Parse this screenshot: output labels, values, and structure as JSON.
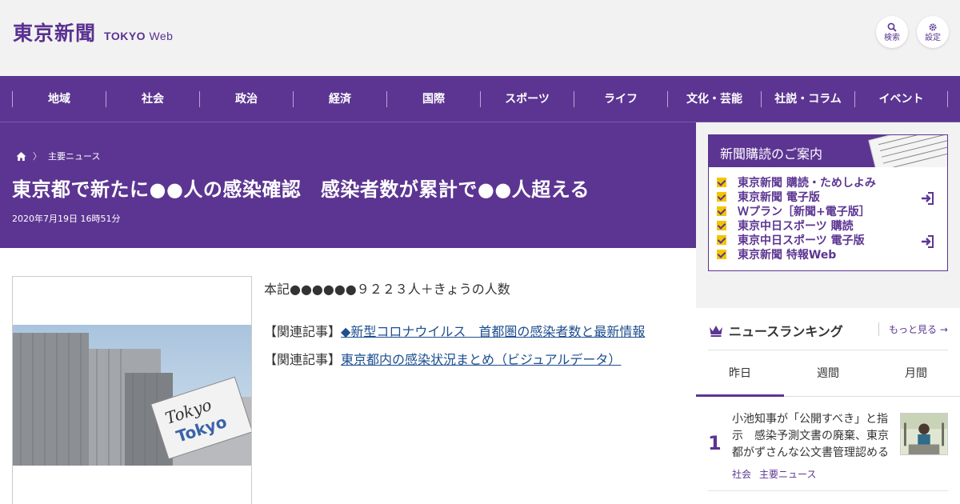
{
  "header": {
    "logo_jp": "東京新聞",
    "logo_en": "TOKYO",
    "logo_web": "Web",
    "search_label": "検索",
    "settings_label": "設定"
  },
  "nav": {
    "items": [
      "地域",
      "社会",
      "政治",
      "経済",
      "国際",
      "スポーツ",
      "ライフ",
      "文化・芸能",
      "社説・コラム",
      "イベント"
    ]
  },
  "article": {
    "breadcrumb": "主要ニュース",
    "title": "東京都で新たに●●人の感染確認　感染者数が累計で●●人超える",
    "date": "2020年7月19日 16時51分",
    "body": "本記●●●●●●９２２３人＋きょうの人数",
    "related_prefix": "【関連記事】",
    "related_links": [
      "◆新型コロナウイルス　首都圏の感染者数と最新情報",
      "東京都内の感染状況まとめ（ビジュアルデータ）"
    ]
  },
  "subscription": {
    "title": "新聞購読のご案内",
    "items": [
      "東京新聞 購読・ためしよみ",
      "東京新聞 電子版",
      "Ｗプラン［新聞+電子版］",
      "東京中日スポーツ 購読",
      "東京中日スポーツ 電子版",
      "東京新聞 特報Web"
    ]
  },
  "ranking": {
    "title": "ニュースランキング",
    "more": "もっと見る",
    "tabs": [
      "昨日",
      "週間",
      "月間"
    ],
    "items": [
      {
        "rank": "1",
        "title": "小池知事が「公開すべき」と指示　感染予測文書の廃棄、東京都がずさんな公文書管理認める",
        "tags": [
          "社会",
          "主要ニュース"
        ]
      }
    ]
  },
  "colors": {
    "brand_purple": "#5c3592",
    "check_yellow": "#f2c500",
    "link_blue": "#1d4e8f"
  }
}
